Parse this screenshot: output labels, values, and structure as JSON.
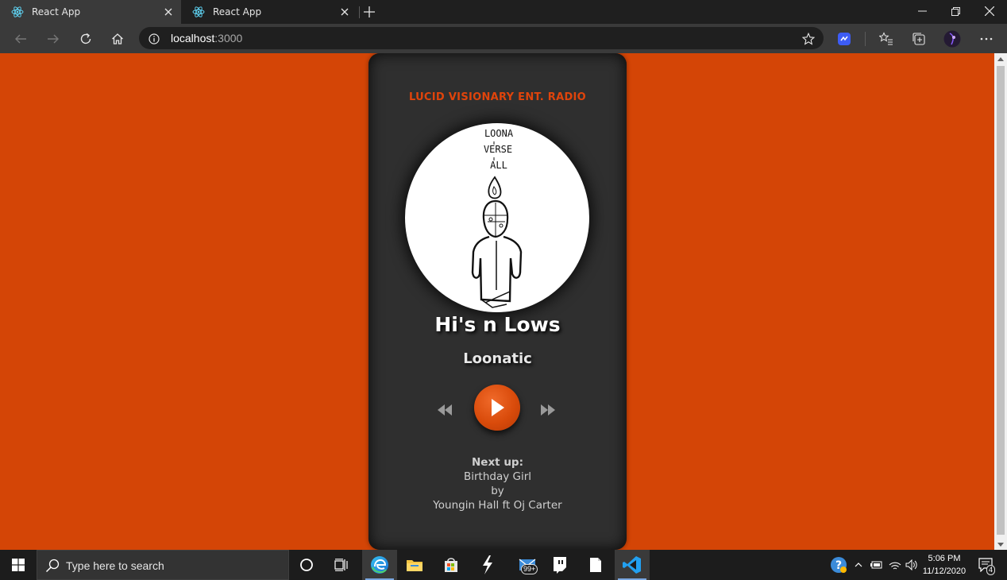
{
  "browser": {
    "tabs": [
      {
        "title": "React App",
        "active": true
      },
      {
        "title": "React App",
        "active": false
      }
    ],
    "url_host": "localhost",
    "url_port": ":3000"
  },
  "page": {
    "background_color": "#d44506",
    "station": "LUCID VISIONARY ENT. RADIO",
    "artwork_text": [
      "LOONA",
      "VERSE",
      "ALL"
    ],
    "song_title": "Hi's n Lows",
    "artist": "Loonatic",
    "next_up": {
      "heading": "Next up:",
      "title": "Birthday Girl",
      "by": "by",
      "artist": "Youngin Hall ft Oj Carter"
    },
    "accent_color": "#e0440b"
  },
  "taskbar": {
    "search_placeholder": "Type here to search",
    "mail_badge": "99+",
    "time": "5:06 PM",
    "date": "11/12/2020",
    "notification_count": "4"
  }
}
